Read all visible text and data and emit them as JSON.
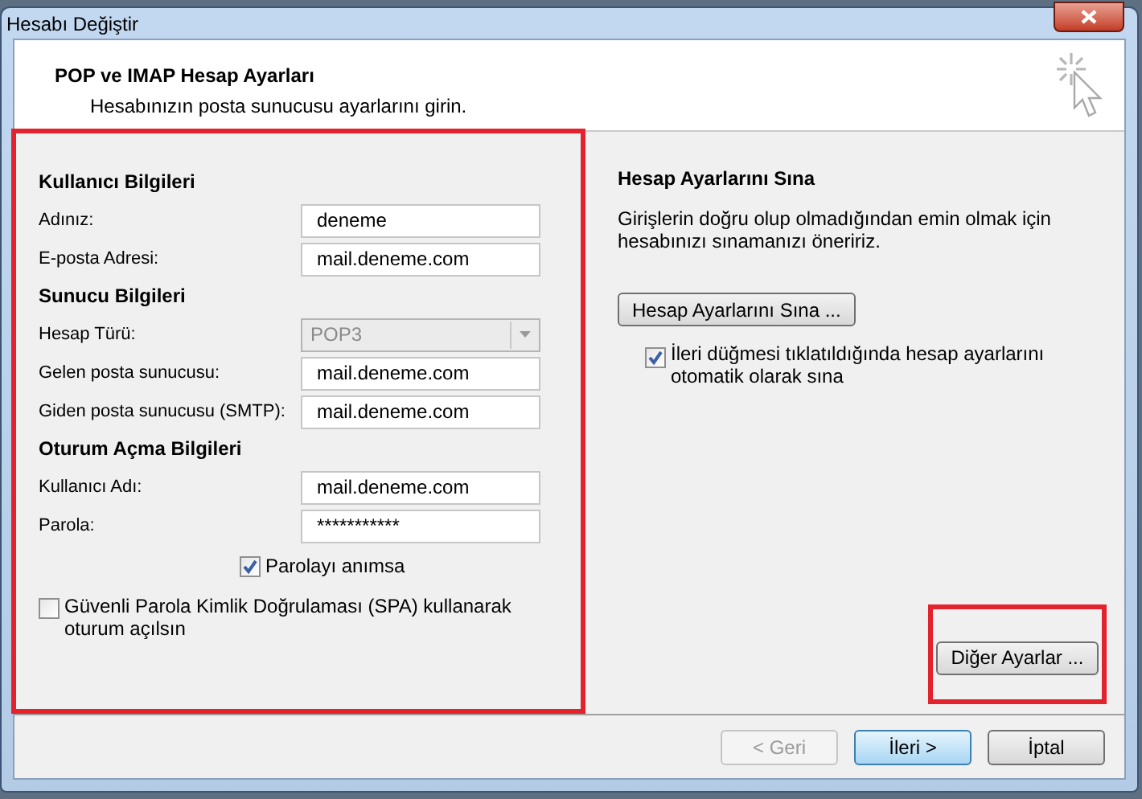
{
  "window": {
    "title": "Hesabı Değiştir"
  },
  "header": {
    "title": "POP ve IMAP Hesap Ayarları",
    "subtitle": "Hesabınızın posta sunucusu ayarlarını girin."
  },
  "form": {
    "sections": [
      {
        "title": "Kullanıcı Bilgileri",
        "fields": [
          {
            "kind": "text",
            "label": "Adınız:",
            "value": "deneme",
            "disabled": false
          },
          {
            "kind": "text",
            "label": "E-posta Adresi:",
            "value": "mail.deneme.com",
            "disabled": false
          }
        ]
      },
      {
        "title": "Sunucu Bilgileri",
        "fields": [
          {
            "kind": "dropdown",
            "label": "Hesap Türü:",
            "value": "POP3",
            "disabled": true
          },
          {
            "kind": "text",
            "label": "Gelen posta sunucusu:",
            "value": "mail.deneme.com",
            "disabled": false
          },
          {
            "kind": "text",
            "label": "Giden posta sunucusu (SMTP):",
            "value": "mail.deneme.com",
            "disabled": false
          }
        ]
      },
      {
        "title": "Oturum Açma Bilgileri",
        "fields": [
          {
            "kind": "text",
            "label": "Kullanıcı Adı:",
            "value": "mail.deneme.com",
            "disabled": false
          },
          {
            "kind": "password",
            "label": "Parola:",
            "value": "***********",
            "disabled": false
          }
        ]
      }
    ],
    "remember_password": {
      "label": "Parolayı anımsa",
      "checked": true
    },
    "spa": {
      "label": "Güvenli Parola Kimlik Doğrulaması (SPA) kullanarak oturum açılsın",
      "checked": false
    }
  },
  "test": {
    "title": "Hesap Ayarlarını Sına",
    "description": "Girişlerin doğru olup olmadığından emin olmak için hesabınızı sınamanızı öneririz.",
    "button": "Hesap Ayarlarını Sına ...",
    "auto_test": {
      "label": "İleri düğmesi tıklatıldığında hesap ayarlarını otomatik olarak sına",
      "checked": true
    }
  },
  "more_settings_button": "Diğer Ayarlar ...",
  "buttons": [
    {
      "label": "< Geri",
      "disabled": true,
      "default": false
    },
    {
      "label": "İleri >",
      "disabled": false,
      "default": true
    },
    {
      "label": "İptal",
      "disabled": false,
      "default": false
    }
  ]
}
